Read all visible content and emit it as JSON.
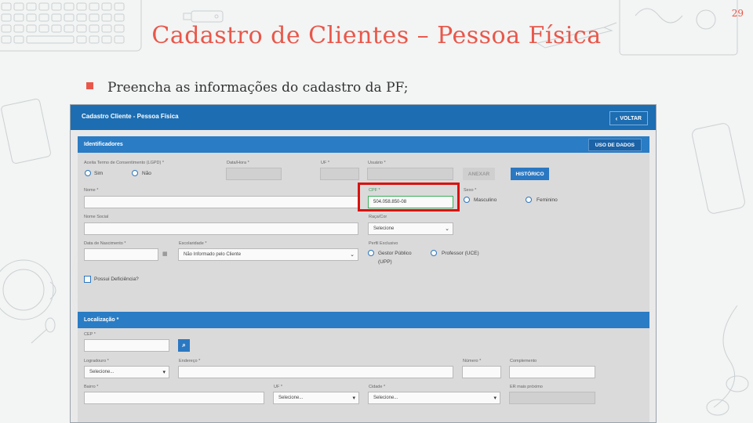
{
  "slide": {
    "title": "Cadastro de Clientes – Pessoa Física",
    "page_number": "29",
    "bullet": "Preencha as informações do cadastro da PF;"
  },
  "app": {
    "header_title": "Cadastro Cliente - Pessoa Física",
    "back_button": "VOLTAR",
    "identificadores": {
      "title": "Identificadores",
      "uso_button": "USO DE DADOS",
      "consent_label": "Aceita Termo de Consentimento (LGPD) *",
      "consent_yes": "Sim",
      "consent_no": "Não",
      "datahora_label": "Data/Hora *",
      "uf_label": "UF *",
      "usuario_label": "Usuário *",
      "anexar_button": "ANEXAR",
      "historico_button": "HISTÓRICO",
      "nome_label": "Nome *",
      "cpf_label": "CPF *",
      "cpf_value": "504.058.850-08",
      "sexo_label": "Sexo *",
      "sexo_m": "Masculino",
      "sexo_f": "Feminino",
      "nome_social_label": "Nome Social",
      "raca_label": "Raça/Cor",
      "raca_value": "Selecione",
      "nascimento_label": "Data de Nascimento *",
      "escolaridade_label": "Escolaridade *",
      "escolaridade_value": "Não Informado pelo Cliente",
      "perfil_label": "Perfil Exclusivo",
      "perfil_gestor": "Gestor Público",
      "perfil_gestor_sub": "(UPP)",
      "perfil_prof": "Professor (UCE)",
      "deficiencia_label": "Possui Deficiência?"
    },
    "localizacao": {
      "title": "Localização *",
      "cep_label": "CEP *",
      "logradouro_label": "Logradouro *",
      "logradouro_value": "Selecione...",
      "endereco_label": "Endereço *",
      "numero_label": "Número *",
      "complemento_label": "Complemento",
      "bairro_label": "Bairro *",
      "uf_label": "UF *",
      "uf_value": "Selecione...",
      "cidade_label": "Cidade *",
      "cidade_value": "Selecione...",
      "er_label": "ER mais próximo"
    }
  }
}
